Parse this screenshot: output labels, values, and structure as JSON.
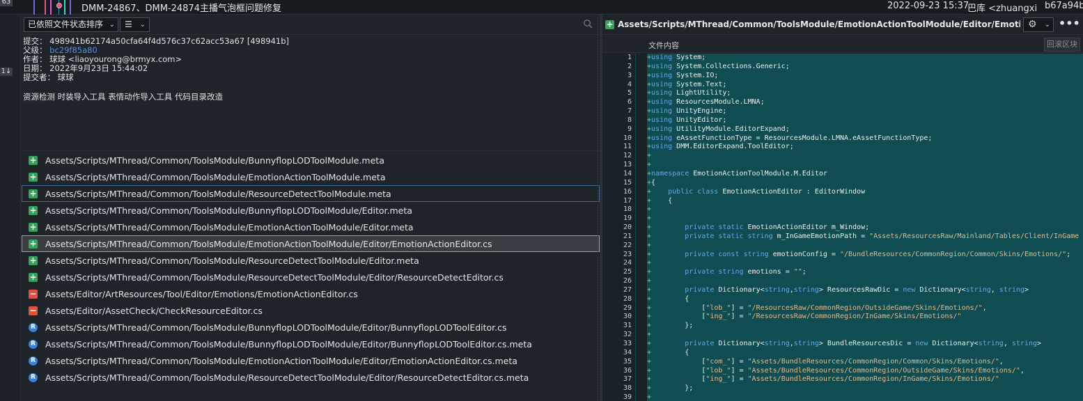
{
  "top_commit": {
    "subject": "DMM-24867、DMM-24874主播气泡框问题修复",
    "date": "2022-09-23 15:37",
    "author": "巴库 <zhuangxiao",
    "hash": "b67a94b",
    "graph_colors": [
      "#6a6fd8",
      "#e05a7a",
      "#e05ad8",
      "#3a8fd8",
      "#3ad8c8"
    ]
  },
  "gutter": {
    "badge_top": "63",
    "badge": "1↓"
  },
  "left": {
    "sort_label": "已依照文件状态排序",
    "view_label": "☰",
    "commit_info": {
      "commit_label": "提交：",
      "commit_value": "498941b62174a50cfa64f4d576c37c62acc53a67 [498941b]",
      "parent_label": "父级：",
      "parent_value": "bc29f85a80",
      "author_label": "作者：",
      "author_value": "球球 <liaoyourong@brmyx.com>",
      "date_label": "日期：",
      "date_value": "2022年9月23日 15:44:02",
      "committer_label": "提交者：",
      "committer_value": "球球"
    },
    "message": "资源检测 时装导入工具 表情动作导入工具 代码目录改造",
    "files": [
      {
        "status": "add",
        "path": "Assets/Scripts/MThread/Common/ToolsModule/BunnyflopLODToolModule.meta"
      },
      {
        "status": "add",
        "path": "Assets/Scripts/MThread/Common/ToolsModule/EmotionActionToolModule.meta"
      },
      {
        "status": "add",
        "path": "Assets/Scripts/MThread/Common/ToolsModule/ResourceDetectToolModule.meta"
      },
      {
        "status": "add",
        "path": "Assets/Scripts/MThread/Common/ToolsModule/BunnyflopLODToolModule/Editor.meta"
      },
      {
        "status": "add",
        "path": "Assets/Scripts/MThread/Common/ToolsModule/EmotionActionToolModule/Editor.meta"
      },
      {
        "status": "add",
        "path": "Assets/Scripts/MThread/Common/ToolsModule/EmotionActionToolModule/Editor/EmotionActionEditor.cs"
      },
      {
        "status": "add",
        "path": "Assets/Scripts/MThread/Common/ToolsModule/ResourceDetectToolModule/Editor.meta"
      },
      {
        "status": "add",
        "path": "Assets/Scripts/MThread/Common/ToolsModule/ResourceDetectToolModule/Editor/ResourceDetectEditor.cs"
      },
      {
        "status": "del",
        "path": "Assets/Editor/ArtResources/Tool/Editor/Emotions/EmotionActionEditor.cs"
      },
      {
        "status": "del",
        "path": "Assets/Editor/AssetCheck/CheckResourceEditor.cs"
      },
      {
        "status": "ren",
        "path": "Assets/Scripts/MThread/Common/ToolsModule/BunnyflopLODToolModule/Editor/BunnyflopLODToolEditor.cs"
      },
      {
        "status": "ren",
        "path": "Assets/Scripts/MThread/Common/ToolsModule/BunnyflopLODToolModule/Editor/BunnyflopLODToolEditor.cs.meta"
      },
      {
        "status": "ren",
        "path": "Assets/Scripts/MThread/Common/ToolsModule/EmotionActionToolModule/Editor/EmotionActionEditor.cs.meta"
      },
      {
        "status": "ren",
        "path": "Assets/Scripts/MThread/Common/ToolsModule/ResourceDetectToolModule/Editor/ResourceDetectEditor.cs.meta"
      }
    ]
  },
  "right": {
    "path": "Assets/Scripts/MThread/Common/ToolsModule/EmotionActionToolModule/Editor/EmotionActionEdito...",
    "content_title": "文件内容",
    "revert_label": "回滚区块",
    "code_lines": [
      [
        {
          "k": "kw",
          "t": "using"
        },
        {
          "k": "",
          "t": " System;"
        }
      ],
      [
        {
          "k": "kw",
          "t": "using"
        },
        {
          "k": "",
          "t": " System.Collections.Generic;"
        }
      ],
      [
        {
          "k": "kw",
          "t": "using"
        },
        {
          "k": "",
          "t": " System.IO;"
        }
      ],
      [
        {
          "k": "kw",
          "t": "using"
        },
        {
          "k": "",
          "t": " System.Text;"
        }
      ],
      [
        {
          "k": "kw",
          "t": "using"
        },
        {
          "k": "",
          "t": " LightUtility;"
        }
      ],
      [
        {
          "k": "kw",
          "t": "using"
        },
        {
          "k": "",
          "t": " ResourcesModule.LMNA;"
        }
      ],
      [
        {
          "k": "kw",
          "t": "using"
        },
        {
          "k": "",
          "t": " UnityEngine;"
        }
      ],
      [
        {
          "k": "kw",
          "t": "using"
        },
        {
          "k": "",
          "t": " UnityEditor;"
        }
      ],
      [
        {
          "k": "kw",
          "t": "using"
        },
        {
          "k": "",
          "t": " UtilityModule.EditorExpand;"
        }
      ],
      [
        {
          "k": "kw",
          "t": "using"
        },
        {
          "k": "",
          "t": " eAssetFunctionType = ResourcesModule.LMNA.eAssetFunctionType;"
        }
      ],
      [
        {
          "k": "kw",
          "t": "using"
        },
        {
          "k": "",
          "t": " DMM.EditorExpand.ToolEditor;"
        }
      ],
      [],
      [],
      [
        {
          "k": "kw",
          "t": "namespace"
        },
        {
          "k": "",
          "t": " EmotionActionToolModule.M.Editor"
        }
      ],
      [
        {
          "k": "",
          "t": "{"
        }
      ],
      [
        {
          "k": "",
          "t": "    "
        },
        {
          "k": "kw",
          "t": "public class"
        },
        {
          "k": "",
          "t": " EmotionActionEditor : EditorWindow"
        }
      ],
      [
        {
          "k": "",
          "t": "    {"
        }
      ],
      [
        {
          "k": "",
          "t": "        "
        }
      ],
      [
        {
          "k": "",
          "t": "        "
        }
      ],
      [
        {
          "k": "",
          "t": "        "
        },
        {
          "k": "kw",
          "t": "private static"
        },
        {
          "k": "",
          "t": " EmotionActionEditor m_Window;"
        }
      ],
      [
        {
          "k": "",
          "t": "        "
        },
        {
          "k": "kw",
          "t": "private static string"
        },
        {
          "k": "",
          "t": " m_InGameEmotionPath = "
        },
        {
          "k": "str",
          "t": "\"Assets/ResourcesRaw/Mainland/Tables/Client/InGame"
        }
      ],
      [],
      [
        {
          "k": "",
          "t": "        "
        },
        {
          "k": "kw",
          "t": "private const string"
        },
        {
          "k": "",
          "t": " emotionConfig = "
        },
        {
          "k": "str",
          "t": "\"/BundleResources/CommonRegion/Common/Skins/Emotions/\""
        },
        {
          "k": "",
          "t": ";"
        }
      ],
      [],
      [
        {
          "k": "",
          "t": "        "
        },
        {
          "k": "kw",
          "t": "private string"
        },
        {
          "k": "",
          "t": " emotions = "
        },
        {
          "k": "str",
          "t": "\"\""
        },
        {
          "k": "",
          "t": ";"
        }
      ],
      [],
      [
        {
          "k": "",
          "t": "        "
        },
        {
          "k": "kw",
          "t": "private"
        },
        {
          "k": "",
          "t": " Dictionary<"
        },
        {
          "k": "kw",
          "t": "string"
        },
        {
          "k": "",
          "t": ","
        },
        {
          "k": "kw",
          "t": "string"
        },
        {
          "k": "",
          "t": "> ResourcesRawDic = "
        },
        {
          "k": "kw",
          "t": "new"
        },
        {
          "k": "",
          "t": " Dictionary<"
        },
        {
          "k": "kw",
          "t": "string"
        },
        {
          "k": "",
          "t": ", "
        },
        {
          "k": "kw",
          "t": "string"
        },
        {
          "k": "",
          "t": ">"
        }
      ],
      [
        {
          "k": "",
          "t": "        {"
        }
      ],
      [
        {
          "k": "",
          "t": "            ["
        },
        {
          "k": "str",
          "t": "\"lob_\""
        },
        {
          "k": "",
          "t": "] = "
        },
        {
          "k": "str",
          "t": "\"/ResourcesRaw/CommonRegion/OutsideGame/Skins/Emotions/\""
        },
        {
          "k": "",
          "t": ","
        }
      ],
      [
        {
          "k": "",
          "t": "            ["
        },
        {
          "k": "str",
          "t": "\"ing_\""
        },
        {
          "k": "",
          "t": "] = "
        },
        {
          "k": "str",
          "t": "\"/ResourcesRaw/CommonRegion/InGame/Skins/Emotions/\""
        }
      ],
      [
        {
          "k": "",
          "t": "        };"
        }
      ],
      [],
      [
        {
          "k": "",
          "t": "        "
        },
        {
          "k": "kw",
          "t": "private"
        },
        {
          "k": "",
          "t": " Dictionary<"
        },
        {
          "k": "kw",
          "t": "string"
        },
        {
          "k": "",
          "t": ","
        },
        {
          "k": "kw",
          "t": "string"
        },
        {
          "k": "",
          "t": "> BundleResourcesDic = "
        },
        {
          "k": "kw",
          "t": "new"
        },
        {
          "k": "",
          "t": " Dictionary<"
        },
        {
          "k": "kw",
          "t": "string"
        },
        {
          "k": "",
          "t": ", "
        },
        {
          "k": "kw",
          "t": "string"
        },
        {
          "k": "",
          "t": ">"
        }
      ],
      [
        {
          "k": "",
          "t": "        {"
        }
      ],
      [
        {
          "k": "",
          "t": "            ["
        },
        {
          "k": "str",
          "t": "\"com_\""
        },
        {
          "k": "",
          "t": "] = "
        },
        {
          "k": "str",
          "t": "\"Assets/BundleResources/CommonRegion/Common/Skins/Emotions/\""
        },
        {
          "k": "",
          "t": ","
        }
      ],
      [
        {
          "k": "",
          "t": "            ["
        },
        {
          "k": "str",
          "t": "\"lob_\""
        },
        {
          "k": "",
          "t": "] = "
        },
        {
          "k": "str",
          "t": "\"Assets/BundleResources/CommonRegion/OutsideGame/Skins/Emotions/\""
        },
        {
          "k": "",
          "t": ","
        }
      ],
      [
        {
          "k": "",
          "t": "            ["
        },
        {
          "k": "str",
          "t": "\"ing_\""
        },
        {
          "k": "",
          "t": "] = "
        },
        {
          "k": "str",
          "t": "\"Assets/BundleResources/CommonRegion/InGame/Skins/Emotions/\""
        }
      ],
      [
        {
          "k": "",
          "t": "        };"
        }
      ],
      [
        {
          "k": "",
          "t": "        "
        }
      ]
    ]
  },
  "colors": {
    "added_bg": "#0f4d52",
    "add_icon": "#3aa15a",
    "del_icon": "#e0503a",
    "rename_icon": "#3a7fd8",
    "link": "#5a8fd8"
  }
}
